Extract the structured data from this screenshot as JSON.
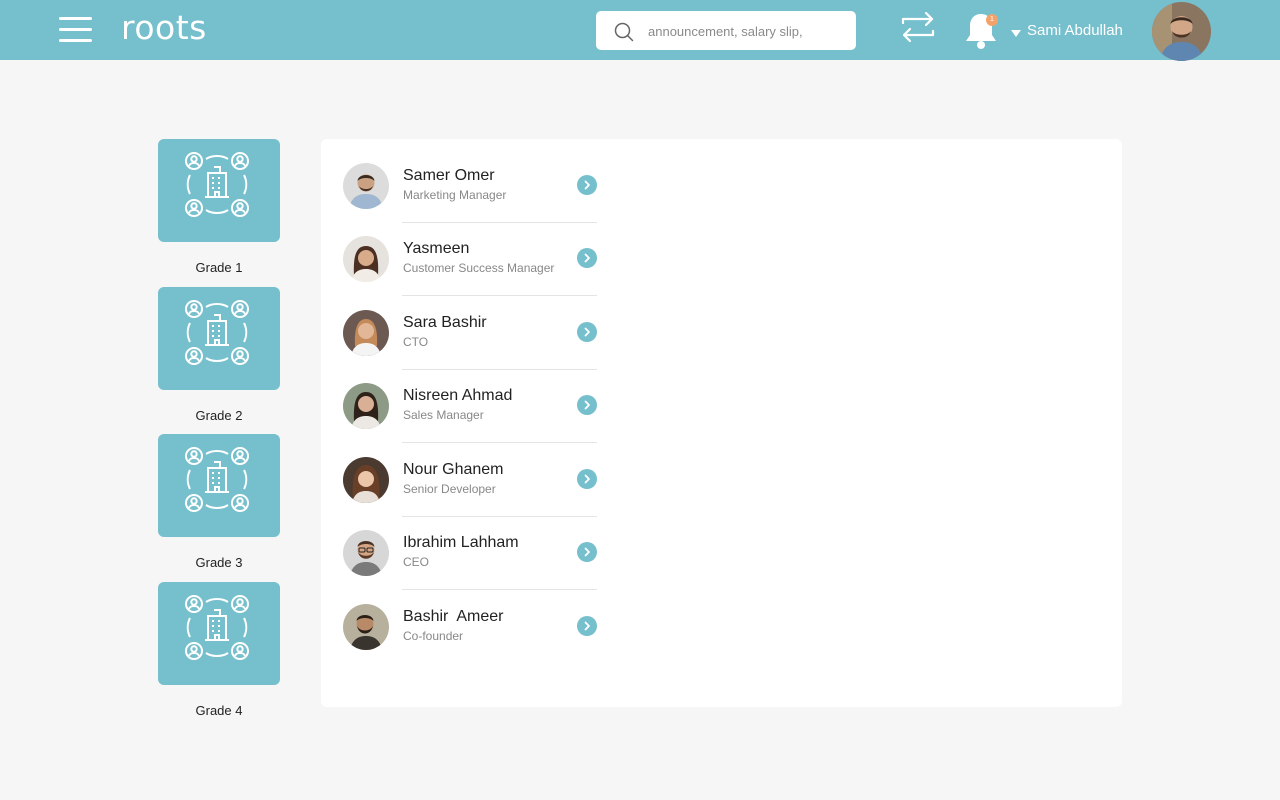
{
  "app": {
    "logo": "roots"
  },
  "search": {
    "placeholder": "announcement, salary slip,"
  },
  "header": {
    "user_name": "Sami Abdullah",
    "notification_count": "1"
  },
  "colors": {
    "accent": "#76bfcd",
    "badge": "#f4a26b",
    "background": "#f6f6f6"
  },
  "grades": [
    {
      "label": "Grade 1",
      "icon": "organization-icon"
    },
    {
      "label": "Grade 2",
      "icon": "organization-icon"
    },
    {
      "label": "Grade 3",
      "icon": "organization-icon"
    },
    {
      "label": "Grade 4",
      "icon": "organization-icon"
    }
  ],
  "employees": [
    {
      "name": "Samer Omer",
      "title": "Marketing Manager"
    },
    {
      "name": "Yasmeen",
      "title": "Customer Success Manager"
    },
    {
      "name": "Sara Bashir",
      "title": "CTO"
    },
    {
      "name": "Nisreen Ahmad",
      "title": "Sales Manager"
    },
    {
      "name": "Nour Ghanem",
      "title": "Senior Developer"
    },
    {
      "name": "Ibrahim Lahham",
      "title": "CEO"
    },
    {
      "name": "Bashir  Ameer",
      "title": "Co-founder"
    }
  ]
}
